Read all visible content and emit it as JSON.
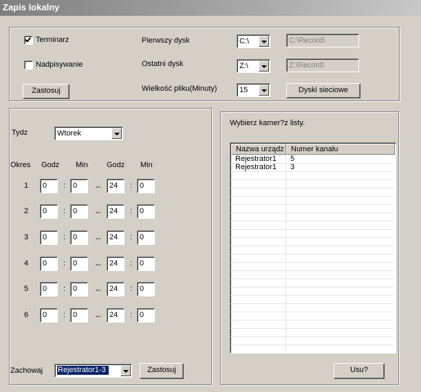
{
  "window": {
    "title": "Zapis lokalny"
  },
  "top": {
    "terminarz": {
      "label": "Terminarz",
      "checked": true
    },
    "nadpisywanie": {
      "label": "Nadpisywanie",
      "checked": false
    },
    "apply_label": "Zastosuj",
    "first_disk": {
      "label": "Pierwszy dysk",
      "value": "C:\\",
      "path": "C:\\Record\\"
    },
    "last_disk": {
      "label": "Ostatni dysk",
      "value": "Z:\\",
      "path": "Z:\\Record\\"
    },
    "file_size": {
      "label": "Wielkość pliku(Minuty)",
      "value": "15"
    },
    "network_disks_label": "Dyski sieciowe"
  },
  "schedule": {
    "week_label": "Tydz",
    "day": "Wtorek",
    "headers": {
      "period": "Okres",
      "hour1": "Godz",
      "min1": "Min",
      "hour2": "Godz",
      "min2": "Min"
    },
    "colon": ":",
    "dash": "--",
    "periods": [
      {
        "n": "1",
        "h1": "0",
        "m1": "0",
        "h2": "24",
        "m2": "0"
      },
      {
        "n": "2",
        "h1": "0",
        "m1": "0",
        "h2": "24",
        "m2": "0"
      },
      {
        "n": "3",
        "h1": "0",
        "m1": "0",
        "h2": "24",
        "m2": "0"
      },
      {
        "n": "4",
        "h1": "0",
        "m1": "0",
        "h2": "24",
        "m2": "0"
      },
      {
        "n": "5",
        "h1": "0",
        "m1": "0",
        "h2": "24",
        "m2": "0"
      },
      {
        "n": "6",
        "h1": "0",
        "m1": "0",
        "h2": "24",
        "m2": "0"
      }
    ],
    "save_label": "Zachowaj",
    "save_target": "Rejestrator1-3",
    "apply_label": "Zastosuj"
  },
  "cameras": {
    "prompt": "Wybierz kamer?z listy.",
    "columns": [
      "Nazwa urządz",
      "Numer kanału"
    ],
    "rows": [
      {
        "device": "Rejestrator1",
        "channel": "5"
      },
      {
        "device": "Rejestrator1",
        "channel": "3"
      }
    ],
    "delete_label": "Usu?"
  }
}
